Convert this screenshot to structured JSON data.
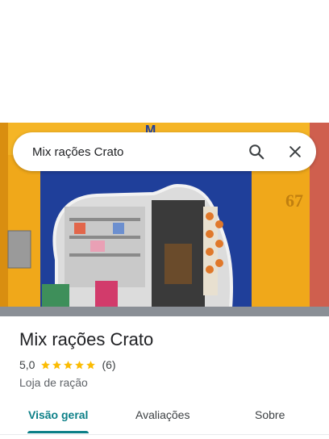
{
  "search": {
    "query": "Mix rações Crato"
  },
  "photo": {
    "storefront_number": "67"
  },
  "place": {
    "name": "Mix rações Crato",
    "rating": "5,0",
    "stars": 5,
    "review_count": "(6)",
    "category": "Loja de ração"
  },
  "tabs": [
    {
      "label": "Visão geral",
      "active": true
    },
    {
      "label": "Avaliações",
      "active": false
    },
    {
      "label": "Sobre",
      "active": false
    }
  ],
  "colors": {
    "accent": "#0b7f87",
    "star": "#fbbc04",
    "storefront_yellow": "#f0a81a",
    "storefront_blue": "#1f3f9a"
  },
  "icons": {
    "search": "search-icon",
    "close": "close-icon",
    "star": "star-icon"
  }
}
